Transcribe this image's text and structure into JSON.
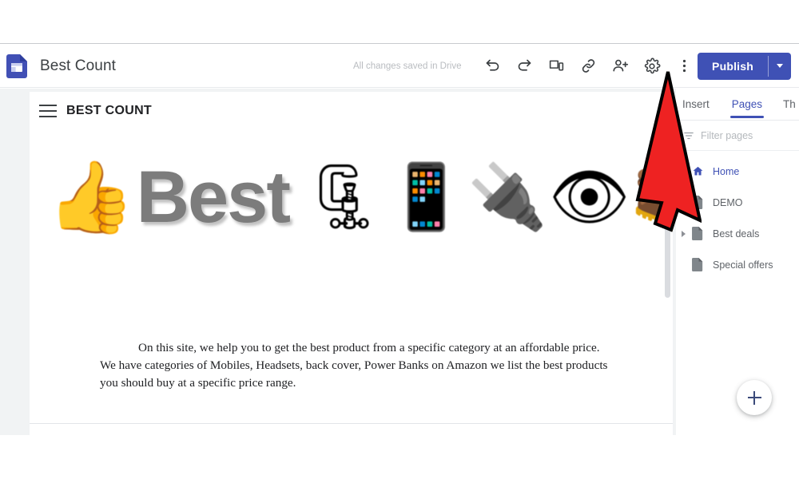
{
  "header": {
    "doc_icon": "sites-file-icon",
    "title": "Best Count",
    "save_status": "All changes saved in Drive",
    "tools": [
      {
        "name": "undo-button",
        "label": "Undo"
      },
      {
        "name": "redo-button",
        "label": "Redo"
      },
      {
        "name": "preview-button",
        "label": "Preview"
      },
      {
        "name": "link-button",
        "label": "Copy published site link"
      },
      {
        "name": "share-button",
        "label": "Add editors"
      },
      {
        "name": "settings-button",
        "label": "Settings"
      },
      {
        "name": "more-button",
        "label": "More"
      }
    ],
    "publish_label": "Publish",
    "publish_color": "#3f51b5"
  },
  "canvas": {
    "site_header": {
      "menu_icon": "hamburger-icon",
      "site_name": "BEST COUNT"
    },
    "banner": {
      "emojis_left": [
        "👍"
      ],
      "word": "Best",
      "emojis_right": [
        "🗜",
        "📱",
        "🔌",
        "👁",
        "🥾"
      ]
    },
    "paragraph": "On this site, we help you to get the best product from a specific category at an affordable price. We have categories of Mobiles, Headsets, back cover, Power Banks on Amazon we list the best products you should buy at a specific price range.",
    "scrollbar": {
      "name": "canvas-scrollbar",
      "thumb_color": "#dadce0"
    }
  },
  "side_panel": {
    "tabs": [
      {
        "label": "Insert",
        "active": false
      },
      {
        "label": "Pages",
        "active": true
      },
      {
        "label": "Th",
        "active": false
      }
    ],
    "filter": {
      "placeholder": "Filter pages",
      "value": "",
      "icon": "filter-icon"
    },
    "pages": [
      {
        "label": "Home",
        "icon": "home-page-icon",
        "active": true,
        "expandable": false
      },
      {
        "label": "DEMO",
        "icon": "page-icon",
        "active": false,
        "expandable": false
      },
      {
        "label": "Best deals",
        "icon": "page-icon",
        "active": false,
        "expandable": true
      },
      {
        "label": "Special offers",
        "icon": "page-icon",
        "active": false,
        "expandable": false
      }
    ],
    "add_page_label": "+"
  },
  "annotation": {
    "arrow": {
      "name": "red-arrow-annotation",
      "fill": "#ee2222",
      "stroke": "#000000",
      "points_to": "settings-button"
    }
  }
}
